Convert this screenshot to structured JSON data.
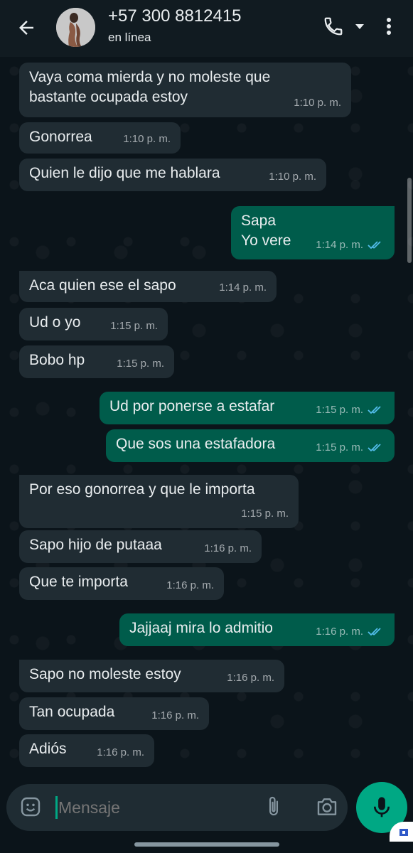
{
  "header": {
    "contact_name": "+57 300 8812415",
    "status": "en línea"
  },
  "messages": [
    {
      "dir": "in",
      "lines": [
        "Vaya coma mierda y no moleste que",
        "bastante ocupada estoy"
      ],
      "time": "1:10 p. m."
    },
    {
      "dir": "in",
      "lines": [
        "Gonorrea"
      ],
      "time": "1:10 p. m."
    },
    {
      "dir": "in",
      "lines": [
        "Quien le dijo que me hablara"
      ],
      "time": "1:10 p. m."
    },
    {
      "dir": "out",
      "lines": [
        "Sapa",
        "Yo vere"
      ],
      "time": "1:14 p. m.",
      "ticks": "read"
    },
    {
      "dir": "in",
      "lines": [
        "Aca quien ese el sapo"
      ],
      "time": "1:14 p. m."
    },
    {
      "dir": "in",
      "lines": [
        "Ud o yo"
      ],
      "time": "1:15 p. m."
    },
    {
      "dir": "in",
      "lines": [
        "Bobo hp"
      ],
      "time": "1:15 p. m."
    },
    {
      "dir": "out",
      "lines": [
        "Ud por ponerse a estafar"
      ],
      "time": "1:15 p. m.",
      "ticks": "read"
    },
    {
      "dir": "out",
      "lines": [
        "Que sos una estafadora"
      ],
      "time": "1:15 p. m.",
      "ticks": "read"
    },
    {
      "dir": "in",
      "lines": [
        "Por eso gonorrea y que le importa"
      ],
      "time": "1:15 p. m."
    },
    {
      "dir": "in",
      "lines": [
        "Sapo hijo de putaaa"
      ],
      "time": "1:16 p. m."
    },
    {
      "dir": "in",
      "lines": [
        "Que te importa"
      ],
      "time": "1:16 p. m."
    },
    {
      "dir": "out",
      "lines": [
        "Jajjaaj mira lo admitio"
      ],
      "time": "1:16 p. m.",
      "ticks": "read"
    },
    {
      "dir": "in",
      "lines": [
        "Sapo no moleste estoy"
      ],
      "time": "1:16 p. m."
    },
    {
      "dir": "in",
      "lines": [
        "Tan ocupada"
      ],
      "time": "1:16 p. m."
    },
    {
      "dir": "in",
      "lines": [
        "Adiós"
      ],
      "time": "1:16 p. m."
    }
  ],
  "composer": {
    "placeholder": "Mensaje",
    "value": ""
  },
  "colors": {
    "background": "#0b141a",
    "header": "#111b21",
    "incoming_bubble": "#202c33",
    "outgoing_bubble": "#005c4b",
    "accent": "#00a884",
    "read_ticks": "#53bdeb"
  },
  "icons": [
    "back-arrow-icon",
    "avatar",
    "phone-icon",
    "chevron-down-icon",
    "more-vert-icon",
    "emoji-icon",
    "paperclip-icon",
    "camera-icon",
    "mic-icon",
    "double-check-icon"
  ]
}
